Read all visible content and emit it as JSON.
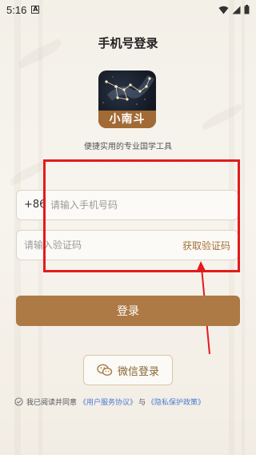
{
  "status_bar": {
    "time": "5:16",
    "indicator": "A"
  },
  "header": {
    "title": "手机号登录"
  },
  "app": {
    "logo_label": "小南斗",
    "subtitle": "便捷实用的专业国学工具"
  },
  "form": {
    "country_code": "+86",
    "phone_placeholder": "请输入手机号码",
    "code_placeholder": "请输入验证码",
    "get_code_label": "获取验证码",
    "login_label": "登录"
  },
  "wechat": {
    "label": "微信登录"
  },
  "agreement": {
    "prefix": "我已阅读并同意",
    "user_agreement": "《用户服务协议》",
    "conjunction": "与",
    "privacy_policy": "《隐私保护政策》"
  },
  "colors": {
    "accent": "#ad7a45",
    "highlight": "#e21b1b",
    "link": "#4c7bd3"
  },
  "icons": [
    "wifi-icon",
    "signal-icon",
    "battery-icon",
    "wechat-icon",
    "check-circle-icon",
    "arrow-annotation"
  ]
}
